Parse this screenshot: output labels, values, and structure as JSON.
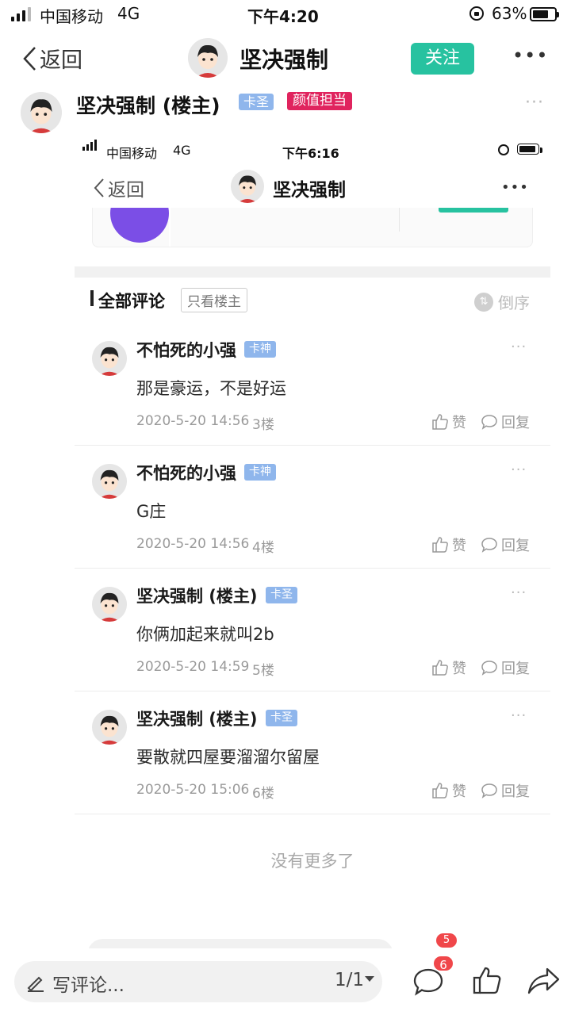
{
  "status_bar": {
    "carrier": "中国移动",
    "network": "4G",
    "time": "下午4:20",
    "battery": "63%",
    "battery_level": 0.63
  },
  "nav": {
    "back_label": "返回",
    "title": "坚决强制",
    "follow_label": "关注",
    "more_icon": "more-dots-icon"
  },
  "post": {
    "author": "坚决强制 (楼主)",
    "tags": [
      "卡圣",
      "颜值担当"
    ]
  },
  "inner": {
    "status_bar": {
      "carrier": "中国移动",
      "network": "4G",
      "time": "下午6:16"
    },
    "nav": {
      "back_label": "返回",
      "title": "坚决强制"
    },
    "comments_header": {
      "title": "全部评论",
      "filter_label": "只看楼主",
      "sort_label": "倒序"
    },
    "comments": [
      {
        "name": "不怕死的小强",
        "tag": "卡神",
        "text": "那是豪运，不是好运",
        "time": "2020-5-20 14:56",
        "floor": "3楼",
        "like": "赞",
        "reply": "回复"
      },
      {
        "name": "不怕死的小强",
        "tag": "卡神",
        "text": "G庄",
        "time": "2020-5-20 14:56",
        "floor": "4楼",
        "like": "赞",
        "reply": "回复"
      },
      {
        "name": "坚决强制 (楼主)",
        "tag": "卡圣",
        "text": "你俩加起来就叫2b",
        "time": "2020-5-20 14:59",
        "floor": "5楼",
        "like": "赞",
        "reply": "回复"
      },
      {
        "name": "坚决强制 (楼主)",
        "tag": "卡圣",
        "text": "要散就四屋要溜溜尔留屋",
        "time": "2020-5-20 15:06",
        "floor": "6楼",
        "like": "赞",
        "reply": "回复"
      }
    ],
    "no_more": "没有更多了",
    "peek_badge": "5"
  },
  "bottom_bar": {
    "comment_placeholder": "写评论...",
    "page_indicator": "1/1",
    "comment_count": "6"
  },
  "colors": {
    "accent": "#27c2a0",
    "tag_blue": "#8fb6ec",
    "tag_red": "#e0245e",
    "badge_red": "#f0474a"
  }
}
